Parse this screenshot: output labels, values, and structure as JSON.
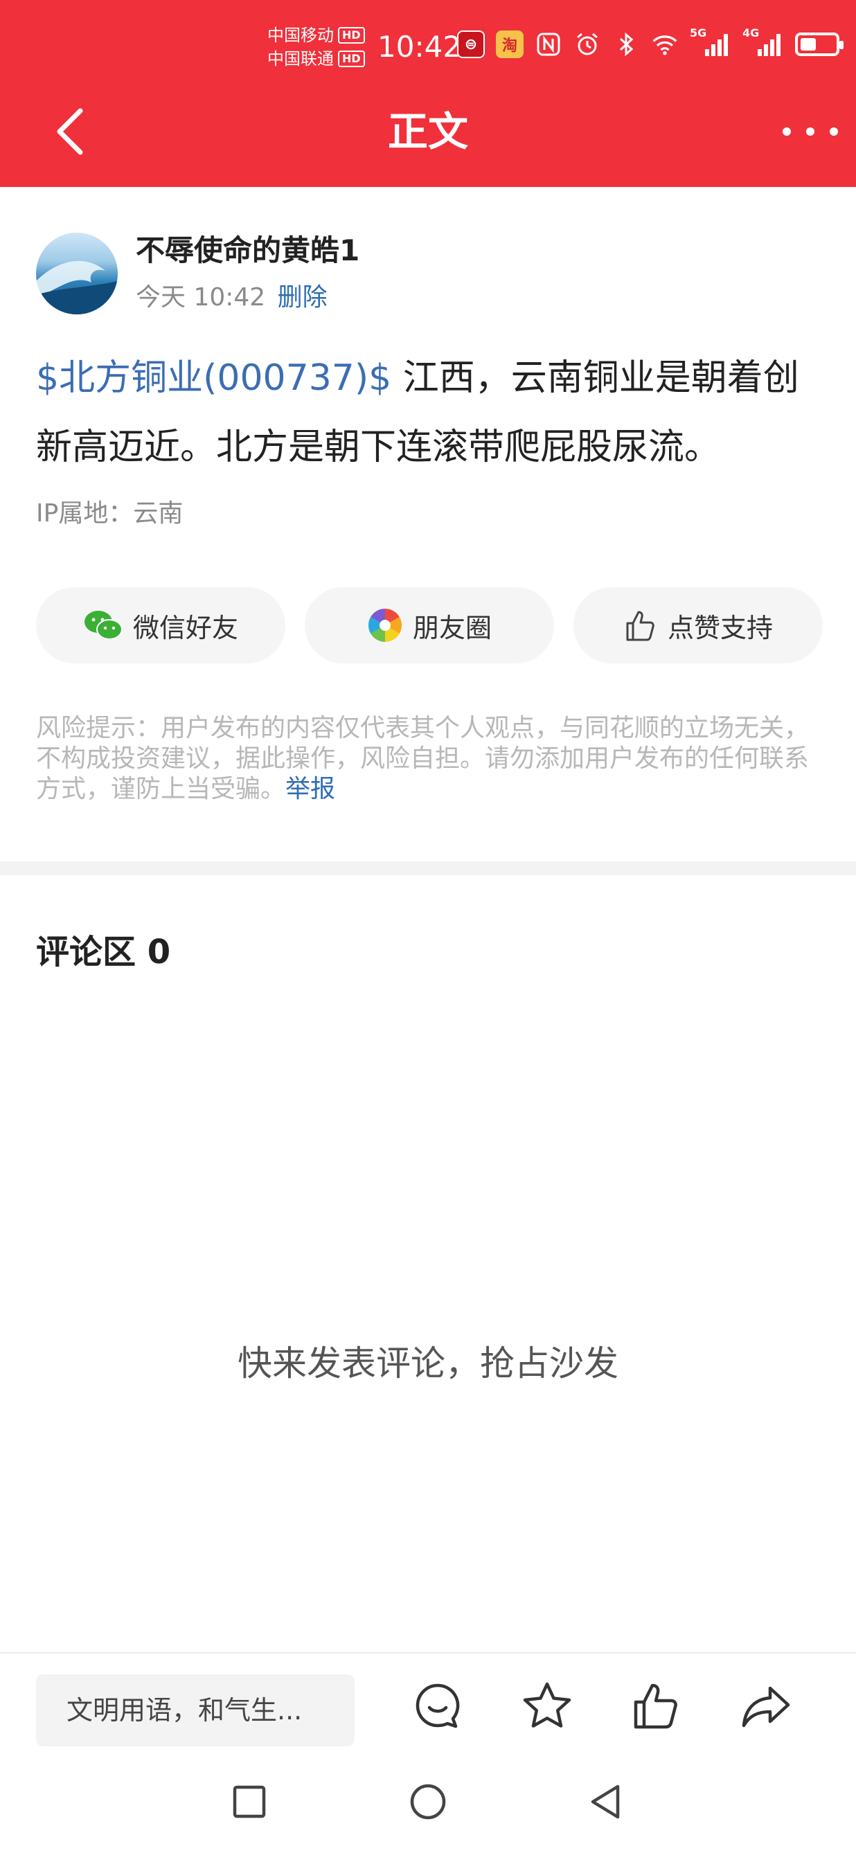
{
  "status_bar": {
    "carrier1": "中国移动",
    "carrier2": "中国联通",
    "hd": "HD",
    "time": "10:42",
    "network1": "5G",
    "network2": "4G",
    "battery_level": 0.45
  },
  "header": {
    "title": "正文",
    "background_color": "#f0303a"
  },
  "post": {
    "author": "不辱使命的黄皓1",
    "time": "今天 10:42",
    "delete_label": "删除",
    "stock_tag": "$北方铜业(000737)$",
    "content": " 江西，云南铜业是朝着创新高迈近。北方是朝下连滚带爬屁股尿流。",
    "ip": "IP属地：云南"
  },
  "share": {
    "wechat_friend": "微信好友",
    "moments": "朋友圈",
    "like_support": "点赞支持"
  },
  "risk": {
    "text": "风险提示：用户发布的内容仅代表其个人观点，与同花顺的立场无关，不构成投资建议，据此操作，风险自担。请勿添加用户发布的任何联系方式，谨防上当受骗。",
    "report_label": "举报"
  },
  "comments": {
    "title": "评论区 0",
    "empty_hint": "快来发表评论，抢占沙发"
  },
  "bottom_bar": {
    "input_placeholder": "文明用语，和气生..."
  },
  "colors": {
    "accent_red": "#f0303a",
    "link_blue": "#2f6db5",
    "stock_blue": "#3b6db3"
  }
}
